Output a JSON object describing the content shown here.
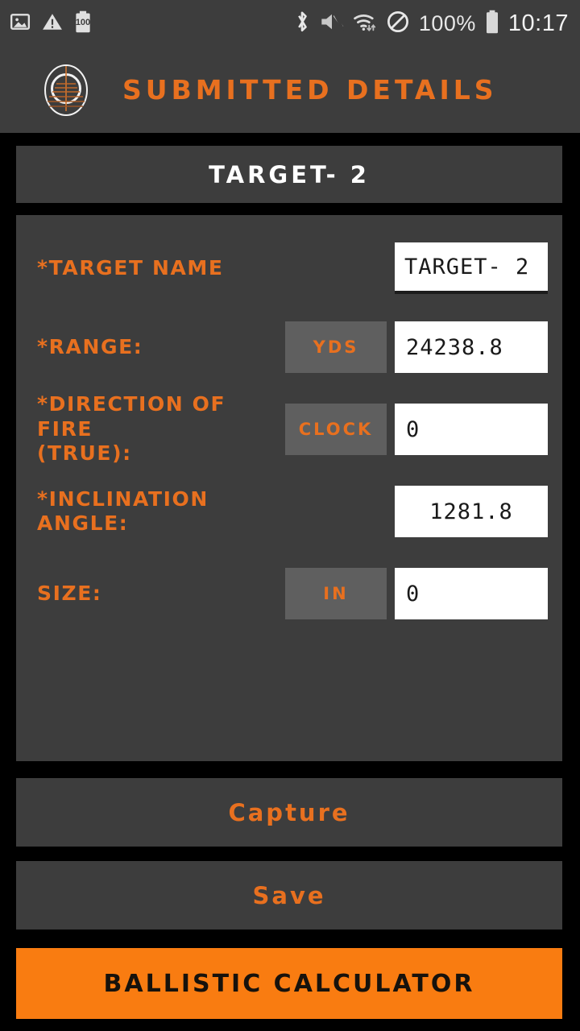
{
  "status_bar": {
    "left_icons": [
      "photo-icon",
      "warning-icon",
      "battery-saver-icon"
    ],
    "battery_badge": "100",
    "right_icons": [
      "bluetooth-icon",
      "volume-mute-icon",
      "wifi-icon",
      "do-not-disturb-icon"
    ],
    "battery_percent": "100%",
    "time": "10:17"
  },
  "header": {
    "logo_icon": "scope-reticle-logo",
    "title": "Submitted Details"
  },
  "target_title": {
    "text": "TARGET- 2"
  },
  "form": {
    "rows": [
      {
        "label": "*Target Name",
        "label_sub": "",
        "unit": "",
        "has_unit": false,
        "value": "TARGET- 2",
        "underlined": true
      },
      {
        "label": "*Range:",
        "label_sub": "",
        "unit": "YDS",
        "has_unit": true,
        "value": "24238.8",
        "underlined": false
      },
      {
        "label": "*Direction of Fire",
        "label_sub": "(True):",
        "unit": "CLOCK",
        "has_unit": true,
        "value": "0",
        "underlined": false
      },
      {
        "label": "*Inclination Angle:",
        "label_sub": "",
        "unit": "",
        "has_unit": false,
        "value": "1281.8",
        "underlined": false
      },
      {
        "label": "Size:",
        "label_sub": "",
        "unit": "IN",
        "has_unit": true,
        "value": "0",
        "underlined": false
      }
    ]
  },
  "actions": {
    "capture": "Capture",
    "save": "Save",
    "calculator": "Ballistic Calculator"
  },
  "colors": {
    "accent_orange": "#e8701f",
    "button_orange": "#f97c11",
    "card_gray": "#3d3d3d",
    "unit_gray": "#5f5f5f",
    "background": "#000000"
  }
}
